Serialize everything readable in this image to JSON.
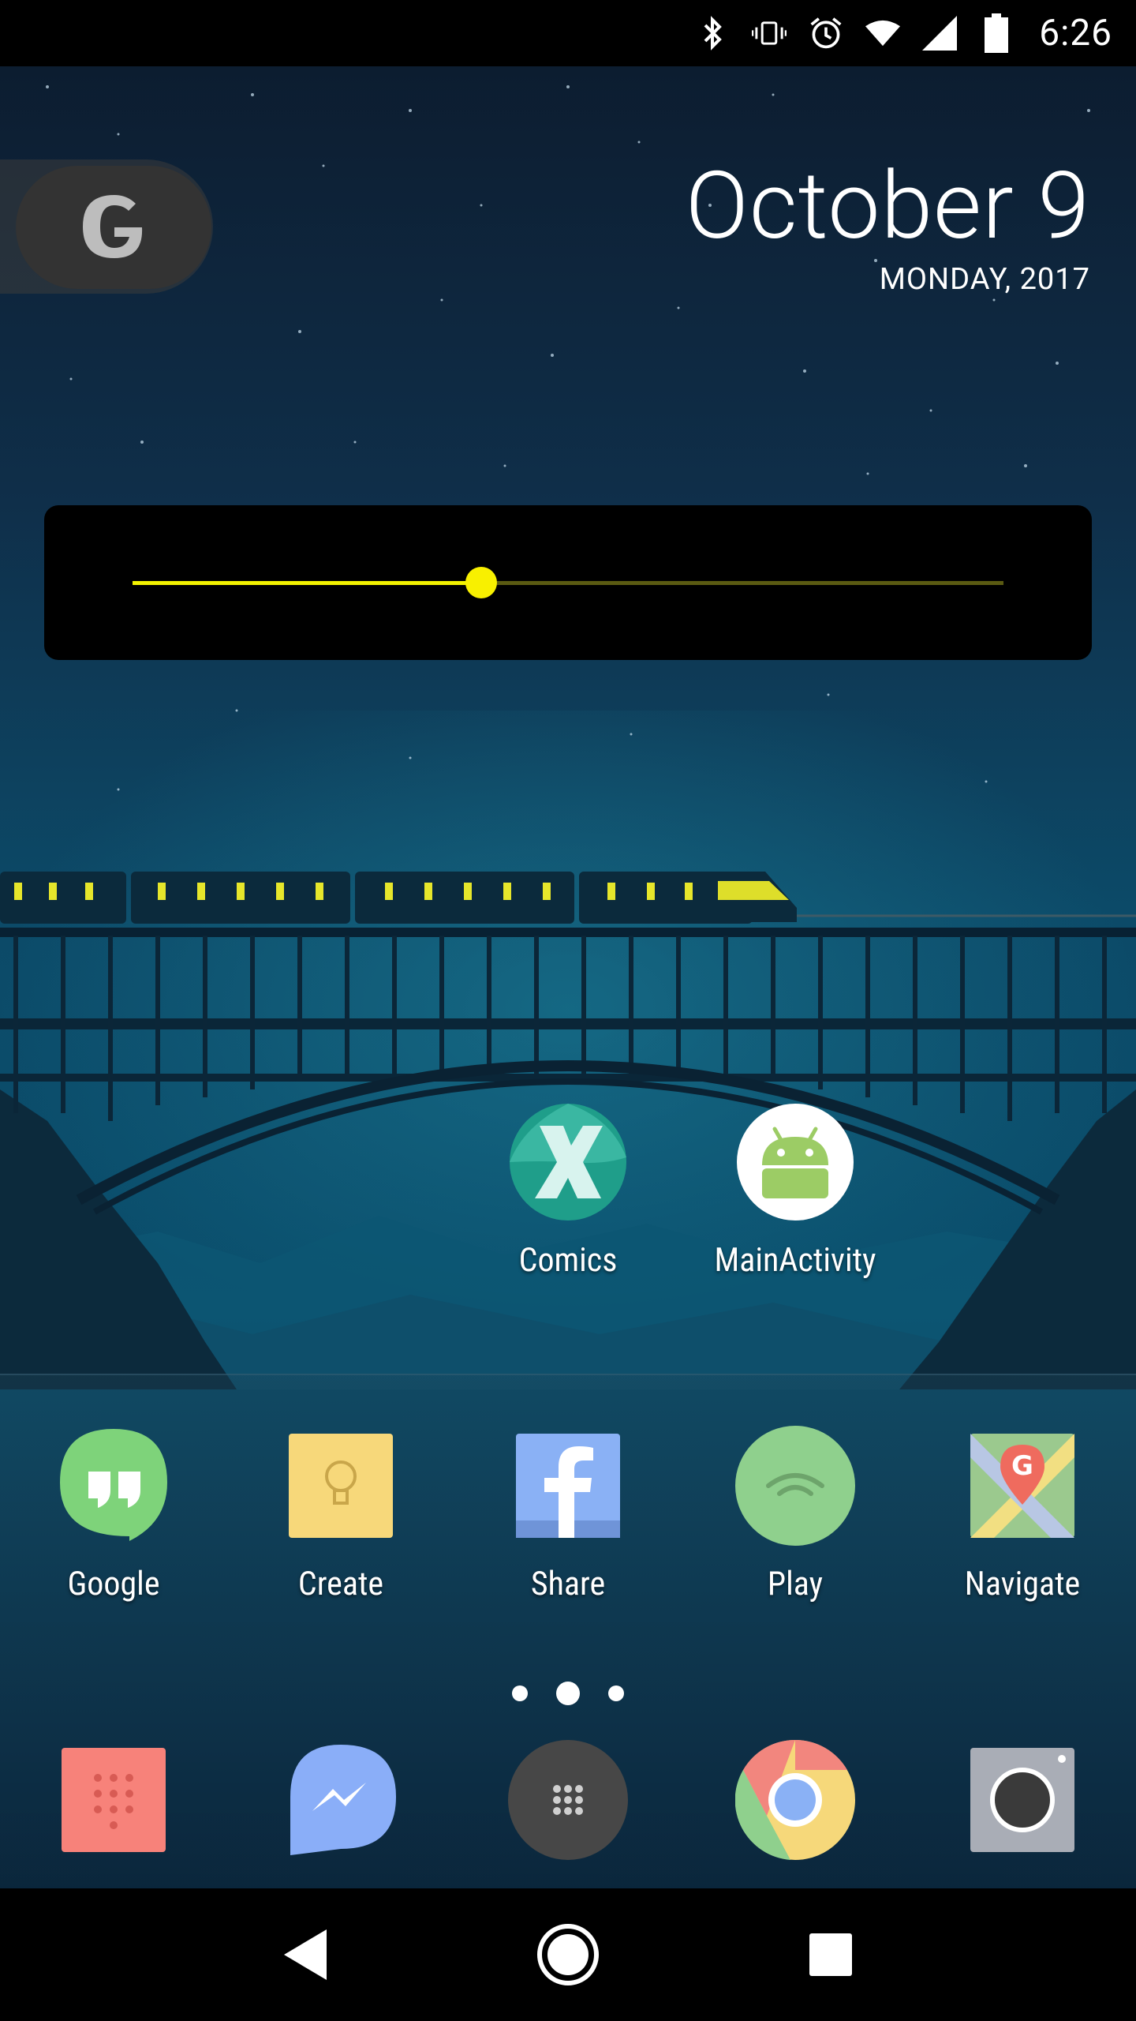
{
  "status_bar": {
    "time": "6:26",
    "icons": [
      "bluetooth-icon",
      "vibrate-icon",
      "alarm-icon",
      "wifi-icon",
      "cell-signal-icon",
      "battery-icon"
    ]
  },
  "google_search": {
    "letter": "G"
  },
  "date_widget": {
    "date": "October 9",
    "day_year": "MONDAY, 2017"
  },
  "slider_widget": {
    "value_fraction": 0.4,
    "accent_color": "#f2f200"
  },
  "home_apps": [
    {
      "label": "Comics",
      "icon": "comics-x-icon"
    },
    {
      "label": "MainActivity",
      "icon": "android-robot-icon"
    }
  ],
  "favorites_row": [
    {
      "label": "Google",
      "icon": "hangouts-icon"
    },
    {
      "label": "Create",
      "icon": "keep-lightbulb-icon"
    },
    {
      "label": "Share",
      "icon": "facebook-icon"
    },
    {
      "label": "Play",
      "icon": "play-icon"
    },
    {
      "label": "Navigate",
      "icon": "maps-icon"
    }
  ],
  "page_indicator": {
    "pages": 3,
    "current": 2
  },
  "dock": [
    {
      "icon": "phone-dialpad-icon"
    },
    {
      "icon": "messenger-icon"
    },
    {
      "icon": "app-drawer-icon"
    },
    {
      "icon": "chrome-icon"
    },
    {
      "icon": "camera-icon"
    }
  ],
  "nav_bar": {
    "buttons": [
      "back-icon",
      "home-icon",
      "recents-icon"
    ]
  }
}
